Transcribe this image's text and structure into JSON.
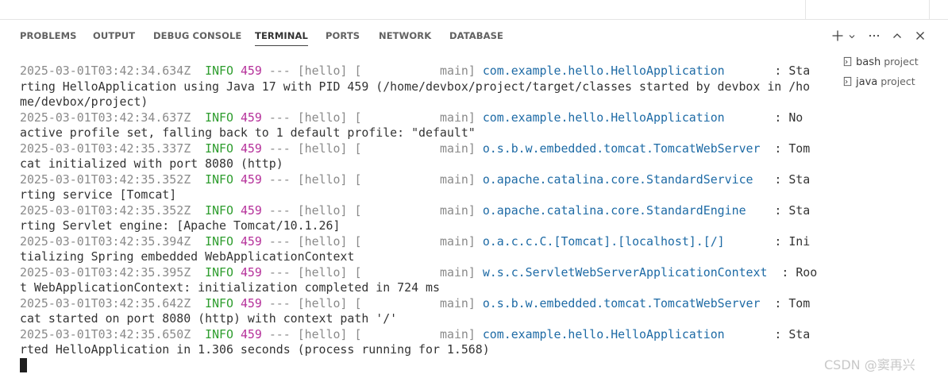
{
  "panel": {
    "tabs": [
      {
        "label": "PROBLEMS"
      },
      {
        "label": "OUTPUT"
      },
      {
        "label": "DEBUG CONSOLE"
      },
      {
        "label": "TERMINAL",
        "active": true
      },
      {
        "label": "PORTS"
      },
      {
        "label": "NETWORK"
      },
      {
        "label": "DATABASE"
      }
    ],
    "actions": {
      "new_terminal_icon": "plus-icon",
      "dropdown_icon": "chevron-down-icon",
      "more_icon": "ellipsis-icon",
      "maximize_icon": "chevron-up-icon",
      "close_icon": "close-icon"
    }
  },
  "terminal": {
    "lines": [
      {
        "ts": "2025-03-01T03:42:34.634Z",
        "level": "INFO",
        "pid": "459",
        "dashes": "---",
        "app": "[hello]",
        "bracket": "[",
        "thread": "main]",
        "logger": "com.example.hello.HelloApplication",
        "colon": ":",
        "msg_start": "Sta"
      },
      {
        "cont": "rting HelloApplication using Java 17 with PID 459 (/home/devbox/project/target/classes started by devbox in /ho"
      },
      {
        "cont": "me/devbox/project)"
      },
      {
        "ts": "2025-03-01T03:42:34.637Z",
        "level": "INFO",
        "pid": "459",
        "dashes": "---",
        "app": "[hello]",
        "bracket": "[",
        "thread": "main]",
        "logger": "com.example.hello.HelloApplication",
        "colon": ":",
        "msg_start": "No"
      },
      {
        "cont": "active profile set, falling back to 1 default profile: \"default\""
      },
      {
        "ts": "2025-03-01T03:42:35.337Z",
        "level": "INFO",
        "pid": "459",
        "dashes": "---",
        "app": "[hello]",
        "bracket": "[",
        "thread": "main]",
        "logger": "o.s.b.w.embedded.tomcat.TomcatWebServer",
        "colon": ":",
        "msg_start": "Tom"
      },
      {
        "cont": "cat initialized with port 8080 (http)"
      },
      {
        "ts": "2025-03-01T03:42:35.352Z",
        "level": "INFO",
        "pid": "459",
        "dashes": "---",
        "app": "[hello]",
        "bracket": "[",
        "thread": "main]",
        "logger": "o.apache.catalina.core.StandardService",
        "colon": ":",
        "msg_start": "Sta"
      },
      {
        "cont": "rting service [Tomcat]"
      },
      {
        "ts": "2025-03-01T03:42:35.352Z",
        "level": "INFO",
        "pid": "459",
        "dashes": "---",
        "app": "[hello]",
        "bracket": "[",
        "thread": "main]",
        "logger": "o.apache.catalina.core.StandardEngine",
        "colon": ":",
        "msg_start": "Sta"
      },
      {
        "cont": "rting Servlet engine: [Apache Tomcat/10.1.26]"
      },
      {
        "ts": "2025-03-01T03:42:35.394Z",
        "level": "INFO",
        "pid": "459",
        "dashes": "---",
        "app": "[hello]",
        "bracket": "[",
        "thread": "main]",
        "logger": "o.a.c.c.C.[Tomcat].[localhost].[/]",
        "colon": ":",
        "msg_start": "Ini"
      },
      {
        "cont": "tializing Spring embedded WebApplicationContext"
      },
      {
        "ts": "2025-03-01T03:42:35.395Z",
        "level": "INFO",
        "pid": "459",
        "dashes": "---",
        "app": "[hello]",
        "bracket": "[",
        "thread": "main]",
        "logger": "w.s.c.ServletWebServerApplicationContext",
        "colon": ":",
        "msg_start": "Roo"
      },
      {
        "cont": "t WebApplicationContext: initialization completed in 724 ms"
      },
      {
        "ts": "2025-03-01T03:42:35.642Z",
        "level": "INFO",
        "pid": "459",
        "dashes": "---",
        "app": "[hello]",
        "bracket": "[",
        "thread": "main]",
        "logger": "o.s.b.w.embedded.tomcat.TomcatWebServer",
        "colon": ":",
        "msg_start": "Tom"
      },
      {
        "cont": "cat started on port 8080 (http) with context path '/'"
      },
      {
        "ts": "2025-03-01T03:42:35.650Z",
        "level": "INFO",
        "pid": "459",
        "dashes": "---",
        "app": "[hello]",
        "bracket": "[",
        "thread": "main]",
        "logger": "com.example.hello.HelloApplication",
        "colon": ":",
        "msg_start": "Sta"
      },
      {
        "cont": "rted HelloApplication in 1.306 seconds (process running for 1.568)"
      }
    ]
  },
  "sessions": [
    {
      "shell": "bash",
      "cwd": "project"
    },
    {
      "shell": "java",
      "cwd": "project"
    }
  ],
  "watermark": "CSDN @窦再兴",
  "colors": {
    "log_level": "#2e9d2e",
    "pid": "#b5309a",
    "logger": "#1d6aa5",
    "timestamp": "#8a8a8a",
    "text": "#333333"
  }
}
